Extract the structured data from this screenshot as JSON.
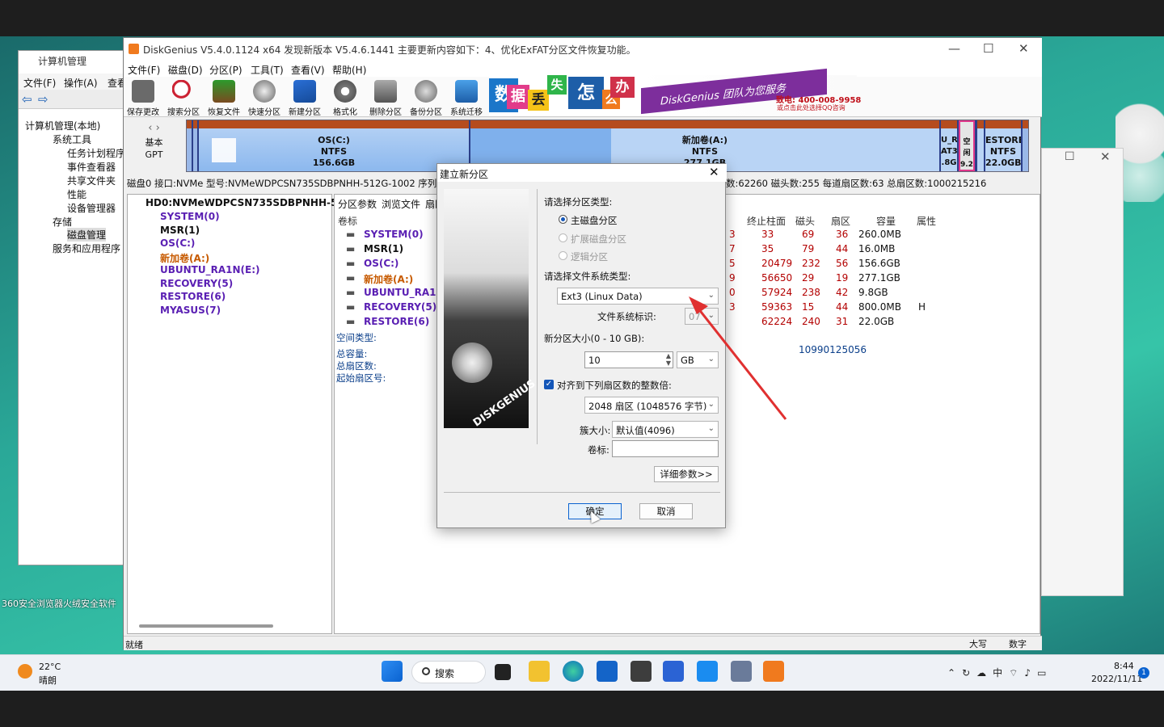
{
  "taskbar": {
    "temperature": "22°C",
    "weather": "晴朗",
    "search_label": "搜索",
    "time": "8:44",
    "date": "2022/11/11",
    "ime": "中",
    "notification_count": "1"
  },
  "desktop": {
    "icon1": "360安全浏览器",
    "icon2": "火绒安全软件"
  },
  "compmgmt": {
    "title": "计算机管理",
    "menu": [
      "文件(F)",
      "操作(A)",
      "查看"
    ],
    "tree": [
      "计算机管理(本地)",
      "系统工具",
      "任务计划程序",
      "事件查看器",
      "共享文件夹",
      "性能",
      "设备管理器",
      "存储",
      "磁盘管理",
      "服务和应用程序"
    ]
  },
  "dg": {
    "title": "DiskGenius V5.4.0.1124 x64   发现新版本 V5.4.6.1441 主要更新内容如下：4、优化ExFAT分区文件恢复功能。",
    "menu": [
      "文件(F)",
      "磁盘(D)",
      "分区(P)",
      "工具(T)",
      "查看(V)",
      "帮助(H)"
    ],
    "toolbar": [
      "保存更改",
      "搜索分区",
      "恢复文件",
      "快速分区",
      "新建分区",
      "格式化",
      "删除分区",
      "备份分区",
      "系统迁移"
    ],
    "banner": {
      "chars": [
        "数",
        "据",
        "丢",
        "失",
        "怎",
        "么",
        "办"
      ],
      "slogan": "DiskGenius 团队为您服务",
      "phone": "致电: 400-008-9958",
      "qq": "或点击此处选择QQ咨询"
    },
    "disk_nav": {
      "line1": "基本",
      "line2": "GPT"
    },
    "segments": {
      "os": {
        "name": "OS(C:)",
        "fs": "NTFS",
        "size": "156.6GB"
      },
      "new": {
        "name": "新加卷(A:)",
        "fs": "NTFS",
        "size": "277.1GB"
      },
      "u": {
        "name": "U_R",
        "fs": "AT3",
        "size": ".8G"
      },
      "free": {
        "name": "空闲",
        "size": "9.20"
      },
      "restore": {
        "name": "ESTORE(",
        "fs": "NTFS",
        "size": "22.0GB"
      }
    },
    "disk_info_left": "磁盘0 接口:NVMe  型号:NVMeWDPCSN735SDBPNHH-512G-1002  序列号",
    "disk_info_right": "数:62260  磁头数:255  每道扇区数:63  总扇区数:1000215216",
    "tree_root": "HD0:NVMeWDPCSN735SDBPNHH-51",
    "tree_items": [
      "SYSTEM(0)",
      "MSR(1)",
      "OS(C:)",
      "新加卷(A:)",
      "UBUNTU_RA1N(E:)",
      "RECOVERY(5)",
      "RESTORE(6)",
      "MYASUS(7)"
    ],
    "tabs": [
      "分区参数",
      "浏览文件",
      "扇区"
    ],
    "table_headers": {
      "label": "卷标",
      "end_cyl": "终止柱面",
      "head": "磁头",
      "sector": "扇区",
      "capacity": "容量",
      "attr": "属性"
    },
    "rows": [
      {
        "name": "SYSTEM(0)",
        "c0": "3",
        "end": "33",
        "head": "69",
        "sec": "36",
        "cap": "260.0MB",
        "attr": ""
      },
      {
        "name": "MSR(1)",
        "c0": "7",
        "end": "35",
        "head": "79",
        "sec": "44",
        "cap": "16.0MB",
        "attr": ""
      },
      {
        "name": "OS(C:)",
        "c0": "5",
        "end": "20479",
        "head": "232",
        "sec": "56",
        "cap": "156.6GB",
        "attr": ""
      },
      {
        "name": "新加卷(A:)",
        "c0": "9",
        "end": "56650",
        "head": "29",
        "sec": "19",
        "cap": "277.1GB",
        "attr": ""
      },
      {
        "name": "UBUNTU_RA1N(",
        "c0": "0",
        "end": "57924",
        "head": "238",
        "sec": "42",
        "cap": "9.8GB",
        "attr": ""
      },
      {
        "name": "RECOVERY(5)",
        "c0": "3",
        "end": "59363",
        "head": "15",
        "sec": "44",
        "cap": "800.0MB",
        "attr": "H"
      },
      {
        "name": "RESTORE(6)",
        "c0": "",
        "end": "62224",
        "head": "240",
        "sec": "31",
        "cap": "22.0GB",
        "attr": ""
      }
    ],
    "panel_info": [
      "空间类型:",
      "总容量:",
      "总扇区数:",
      "起始扇区号:"
    ],
    "panel_number": "10990125056",
    "status_left": "就绪",
    "status_caps": "大写",
    "status_num": "数字"
  },
  "dialog": {
    "title": "建立新分区",
    "type_prompt": "请选择分区类型:",
    "type_primary": "主磁盘分区",
    "type_extended": "扩展磁盘分区",
    "type_logical": "逻辑分区",
    "fs_prompt": "请选择文件系统类型:",
    "fs_value": "Ext3 (Linux Data)",
    "fs_id_label": "文件系统标识:",
    "fs_id_value": "07",
    "size_label": "新分区大小(0 - 10 GB):",
    "size_value": "10",
    "size_unit": "GB",
    "align_label": "对齐到下列扇区数的整数倍:",
    "align_value": "2048 扇区 (1048576 字节)",
    "cluster_label": "簇大小:",
    "cluster_value": "默认值(4096)",
    "volume_label": "卷标:",
    "volume_value": "",
    "advanced_button": "详细参数>>",
    "ok_button": "确定",
    "cancel_button": "取消",
    "brand_text": "DISKGENIUS"
  }
}
